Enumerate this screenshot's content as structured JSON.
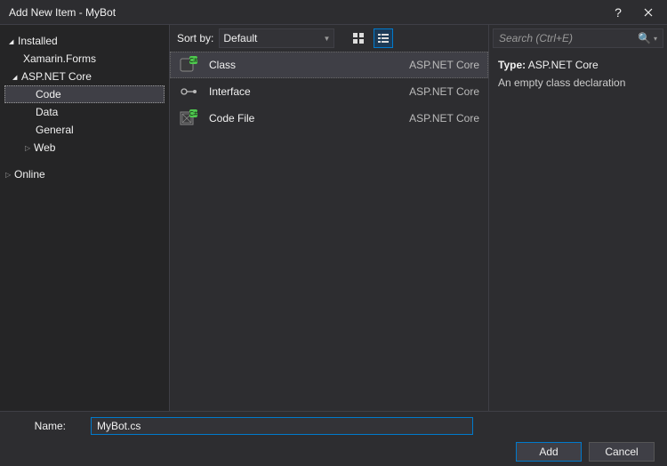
{
  "titlebar": {
    "title": "Add New Item - MyBot"
  },
  "sidebar": {
    "installed": "Installed",
    "xamarin_forms": "Xamarin.Forms",
    "aspnet_core": "ASP.NET Core",
    "code": "Code",
    "data": "Data",
    "general": "General",
    "web": "Web",
    "online": "Online"
  },
  "toolbar": {
    "sortby_label": "Sort by:",
    "sortby_value": "Default"
  },
  "items": [
    {
      "name": "Class",
      "category": "ASP.NET Core",
      "selected": true,
      "icon": "class"
    },
    {
      "name": "Interface",
      "category": "ASP.NET Core",
      "selected": false,
      "icon": "interface"
    },
    {
      "name": "Code File",
      "category": "ASP.NET Core",
      "selected": false,
      "icon": "codefile"
    }
  ],
  "search": {
    "placeholder": "Search (Ctrl+E)"
  },
  "detail": {
    "type_label": "Type:",
    "type_value": "ASP.NET Core",
    "description": "An empty class declaration"
  },
  "bottom": {
    "name_label": "Name:",
    "name_value": "MyBot.cs",
    "add_label": "Add",
    "cancel_label": "Cancel"
  }
}
